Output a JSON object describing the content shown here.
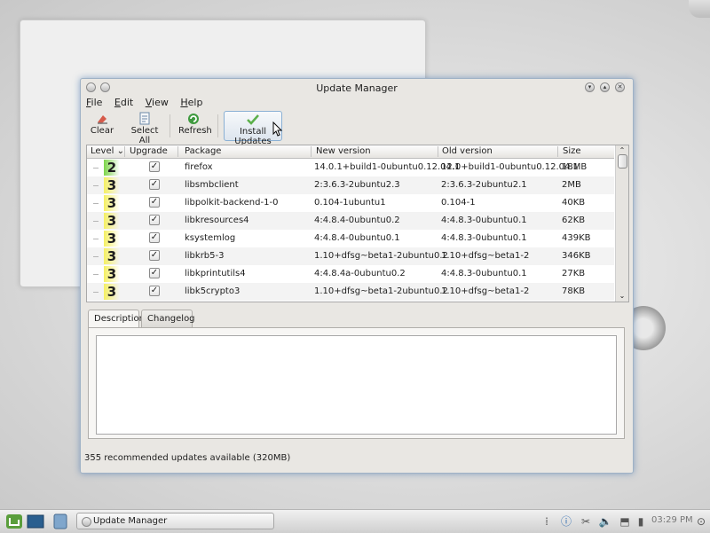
{
  "window": {
    "title": "Update Manager"
  },
  "menu": [
    {
      "u": "F",
      "rest": "ile"
    },
    {
      "u": "E",
      "rest": "dit"
    },
    {
      "u": "V",
      "rest": "iew"
    },
    {
      "u": "H",
      "rest": "elp"
    }
  ],
  "toolbar": {
    "clear": "Clear",
    "select_all": "Select All",
    "refresh": "Refresh",
    "install_updates": "Install Updates"
  },
  "table": {
    "columns": [
      "Level",
      "Upgrade",
      "Package",
      "New version",
      "Old version",
      "Size"
    ],
    "rows": [
      {
        "level": "2",
        "package": "firefox",
        "new": "14.0.1+build1-0ubuntu0.12.04.1",
        "old": "12.0+build1-0ubuntu0.12.04.1",
        "size": "18MB"
      },
      {
        "level": "3",
        "package": "libsmbclient",
        "new": "2:3.6.3-2ubuntu2.3",
        "old": "2:3.6.3-2ubuntu2.1",
        "size": "2MB"
      },
      {
        "level": "3",
        "package": "libpolkit-backend-1-0",
        "new": "0.104-1ubuntu1",
        "old": "0.104-1",
        "size": "40KB"
      },
      {
        "level": "3",
        "package": "libkresources4",
        "new": "4:4.8.4-0ubuntu0.2",
        "old": "4:4.8.3-0ubuntu0.1",
        "size": "62KB"
      },
      {
        "level": "3",
        "package": "ksystemlog",
        "new": "4:4.8.4-0ubuntu0.1",
        "old": "4:4.8.3-0ubuntu0.1",
        "size": "439KB"
      },
      {
        "level": "3",
        "package": "libkrb5-3",
        "new": "1.10+dfsg~beta1-2ubuntu0.2",
        "old": "1.10+dfsg~beta1-2",
        "size": "346KB"
      },
      {
        "level": "3",
        "package": "libkprintutils4",
        "new": "4:4.8.4a-0ubuntu0.2",
        "old": "4:4.8.3-0ubuntu0.1",
        "size": "27KB"
      },
      {
        "level": "3",
        "package": "libk5crypto3",
        "new": "1.10+dfsg~beta1-2ubuntu0.2",
        "old": "1.10+dfsg~beta1-2",
        "size": "78KB"
      }
    ]
  },
  "tabs": [
    {
      "label": "Description",
      "active": true
    },
    {
      "label": "Changelog",
      "active": false
    }
  ],
  "status": "355 recommended updates available (320MB)",
  "taskbar": {
    "task_label": "Update Manager",
    "clock": "03:29 PM"
  },
  "colors": {
    "level2": "#7cd44a",
    "level3": "#f5f063",
    "window_glow": "#5a8fc8"
  }
}
